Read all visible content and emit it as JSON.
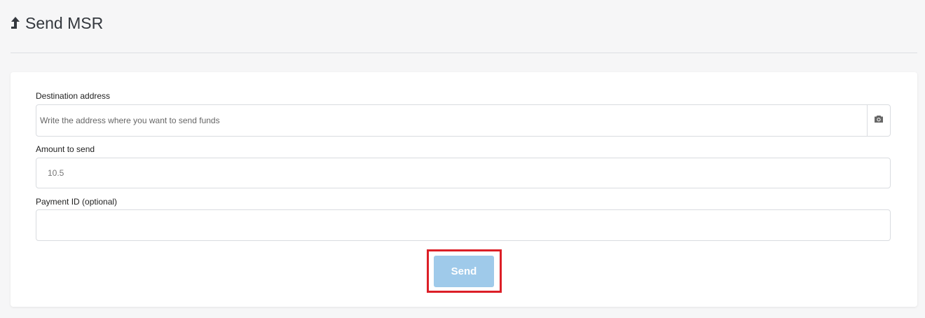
{
  "header": {
    "icon": "arrow-up-icon",
    "title": "Send MSR"
  },
  "form": {
    "destination": {
      "label": "Destination address",
      "placeholder": "Write the address where you want to send funds",
      "value": "",
      "camera_icon": "camera-icon"
    },
    "amount": {
      "label": "Amount to send",
      "value": "10.5"
    },
    "payment_id": {
      "label": "Payment ID (optional)",
      "value": ""
    },
    "send_label": "Send"
  },
  "colors": {
    "send_button": "#9fcaea",
    "highlight": "#dc1f27"
  }
}
